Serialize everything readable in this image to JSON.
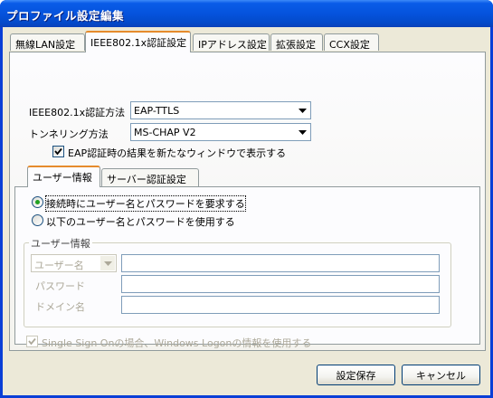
{
  "window": {
    "title": "プロファイル設定編集"
  },
  "tabs": [
    {
      "label": "無線LAN設定"
    },
    {
      "label": "IEEE802.1x認証設定"
    },
    {
      "label": "IPアドレス設定"
    },
    {
      "label": "拡張設定"
    },
    {
      "label": "CCX設定"
    }
  ],
  "auth": {
    "method_label": "IEEE802.1x認証方法",
    "method_value": "EAP-TTLS",
    "tunnel_label": "トンネリング方法",
    "tunnel_value": "MS-CHAP V2",
    "new_window_label": "EAP認証時の結果を新たなウィンドウで表示する"
  },
  "subtabs": [
    {
      "label": "ユーザー情報"
    },
    {
      "label": "サーバー認証設定"
    }
  ],
  "user_info": {
    "radio_prompt_label": "接続時にユーザー名とパスワードを要求する",
    "radio_use_label": "以下のユーザー名とパスワードを使用する",
    "group_title": "ユーザー情報",
    "username_select": "ユーザー名",
    "password_label": "パスワード",
    "domain_label": "ドメイン名",
    "sso_label": "Single Sign Onの場合、Windows Logonの情報を使用する"
  },
  "buttons": {
    "save": "設定保存",
    "cancel": "キャンセル"
  }
}
